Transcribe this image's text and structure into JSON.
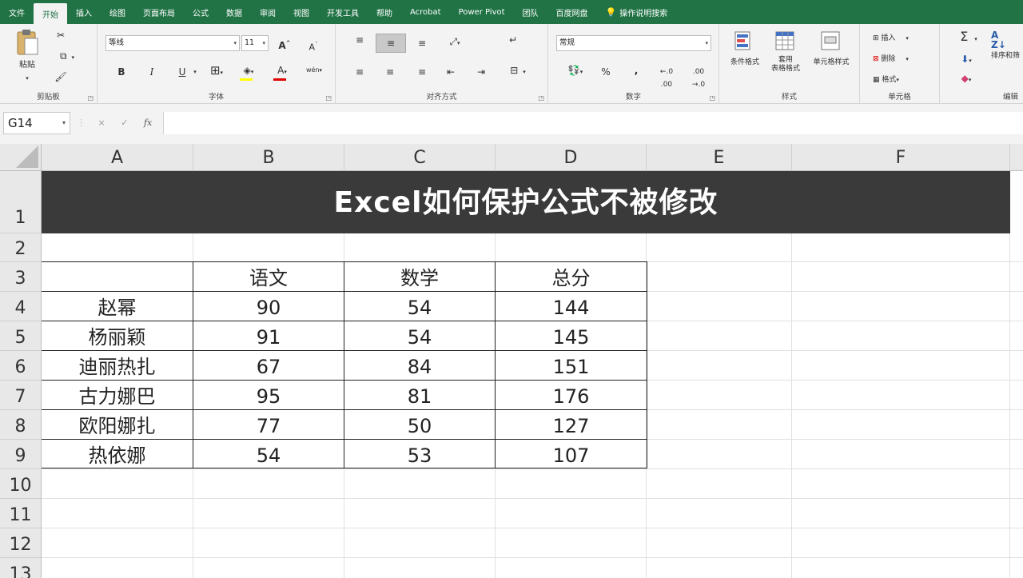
{
  "ribbon_tabs": [
    "文件",
    "开始",
    "插入",
    "绘图",
    "页面布局",
    "公式",
    "数据",
    "审阅",
    "视图",
    "开发工具",
    "帮助",
    "Acrobat",
    "Power Pivot",
    "团队",
    "百度网盘",
    "操作说明搜索"
  ],
  "active_tab": "开始",
  "clipboard": {
    "paste_label": "粘贴",
    "group_label": "剪贴板"
  },
  "font": {
    "name": "等线",
    "size": "11",
    "bold": "B",
    "italic": "I",
    "underline": "U",
    "group_label": "字体",
    "grow": "A",
    "shrink": "A",
    "color_glyph": "A",
    "wen": "wén"
  },
  "alignment": {
    "group_label": "对齐方式"
  },
  "number": {
    "format": "常规",
    "percent": "%",
    "comma": ",",
    "group_label": "数字"
  },
  "styles": {
    "conditional": "条件格式",
    "table_line1": "套用",
    "table_line2": "表格格式",
    "cell_style": "单元格样式",
    "group_label": "样式"
  },
  "cells": {
    "insert": "插入",
    "delete": "删除",
    "format": "格式",
    "group_label": "单元格"
  },
  "editing": {
    "sum": "Σ",
    "sort": "排序和筛",
    "group_label": "编辑"
  },
  "formula_bar": {
    "name_box": "G14",
    "cancel": "×",
    "enter": "✓",
    "fx": "fx",
    "value": ""
  },
  "columns": [
    "A",
    "B",
    "C",
    "D",
    "E",
    "F"
  ],
  "rows": [
    "1",
    "2",
    "3",
    "4",
    "5",
    "6",
    "7",
    "8",
    "9",
    "10",
    "11",
    "12",
    "13"
  ],
  "sheet": {
    "title": "Excel如何保护公式不被修改",
    "headers": [
      "",
      "语文",
      "数学",
      "总分"
    ],
    "data": [
      [
        "赵幂",
        "90",
        "54",
        "144"
      ],
      [
        "杨丽颖",
        "91",
        "54",
        "145"
      ],
      [
        "迪丽热扎",
        "67",
        "84",
        "151"
      ],
      [
        "古力娜巴",
        "95",
        "81",
        "176"
      ],
      [
        "欧阳娜扎",
        "77",
        "50",
        "127"
      ],
      [
        "热依娜",
        "54",
        "53",
        "107"
      ]
    ]
  },
  "colors": {
    "excel_green": "#217346",
    "title_bg": "#3a3a3a",
    "font_red": "#e00000"
  }
}
